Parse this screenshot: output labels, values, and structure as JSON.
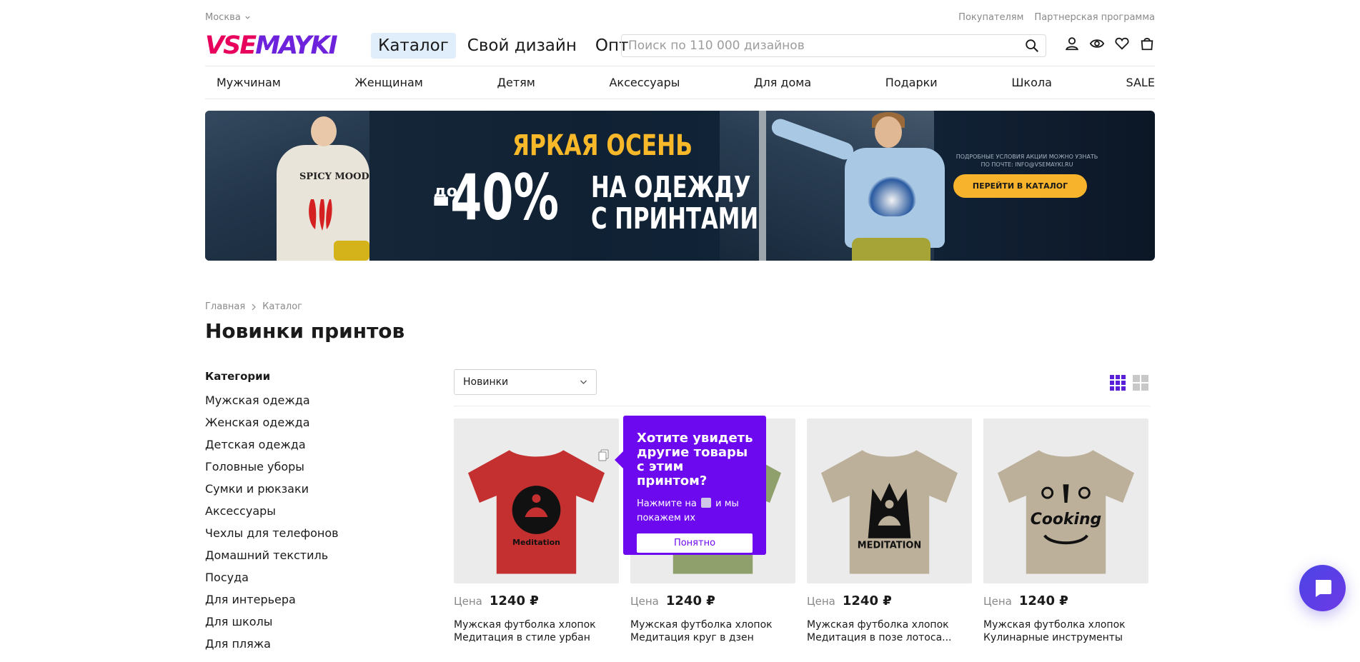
{
  "topline": {
    "city": "Москва",
    "links": [
      "Покупателям",
      "Партнерская программа"
    ]
  },
  "header": {
    "logo": {
      "part1": "VSE",
      "part2": "MAYKI"
    },
    "nav": [
      "Каталог",
      "Свой дизайн",
      "Опт"
    ],
    "search_placeholder": "Поиск по 110 000 дизайнов"
  },
  "catnav": [
    "Мужчинам",
    "Женщинам",
    "Детям",
    "Аксессуары",
    "Для дома",
    "Подарки",
    "Школа",
    "SALE"
  ],
  "banner": {
    "title": "ЯРКАЯ ОСЕНЬ",
    "prefix": "до",
    "percent": "-40%",
    "line1": "НА ОДЕЖДУ",
    "line2": "С ПРИНТАМИ",
    "conditions": "ПОДРОБНЫЕ УСЛОВИЯ АКЦИИ МОЖНО УЗНАТЬ ПО ПОЧТЕ: INFO@VSEMAYKI.RU",
    "button": "ПЕРЕЙТИ В КАТАЛОГ",
    "shirt_text": "SPICY MOOD",
    "colors": {
      "accent": "#f7b829",
      "bg": "#0f2133"
    }
  },
  "breadcrumb": [
    "Главная",
    "Каталог"
  ],
  "page_title": "Новинки принтов",
  "sidebar": {
    "heading": "Категории",
    "items": [
      "Мужская одежда",
      "Женская одежда",
      "Детская одежда",
      "Головные уборы",
      "Сумки и рюкзаки",
      "Аксессуары",
      "Чехлы для телефонов",
      "Домашний текстиль",
      "Посуда",
      "Для интерьера",
      "Для школы",
      "Для пляжа"
    ]
  },
  "sort": {
    "value": "Новинки"
  },
  "products": [
    {
      "price_label": "Цена",
      "price": "1240 ₽",
      "title1": "Мужская футболка хлопок",
      "title2": "Медитация в стиле урбан",
      "shirt_color": "#c43030",
      "print_text": "Meditation"
    },
    {
      "price_label": "Цена",
      "price": "1240 ₽",
      "title1": "Мужская футболка хлопок",
      "title2": "Медитация круг в дзен",
      "shirt_color": "#8fa06c",
      "print_text": ""
    },
    {
      "price_label": "Цена",
      "price": "1240 ₽",
      "title1": "Мужская футболка хлопок",
      "title2": "Медитация в позе лотоса...",
      "shirt_color": "#bcb09a",
      "print_text": "MEDITATION"
    },
    {
      "price_label": "Цена",
      "price": "1240 ₽",
      "title1": "Мужская футболка хлопок",
      "title2": "Кулинарные инструменты",
      "shirt_color": "#bcb09a",
      "print_text": "Cooking"
    }
  ],
  "popover": {
    "heading": "Хотите увидеть другие товары с этим принтом?",
    "text_before": "Нажмите на",
    "text_after": "и мы покажем их",
    "button": "Понятно"
  },
  "icons": {
    "city_chevron": "chevron-down-icon",
    "search": "search-icon",
    "header_icons": [
      "user-icon",
      "eye-icon",
      "heart-icon",
      "bag-icon"
    ],
    "view_switch": [
      "grid-small-icon",
      "grid-large-icon"
    ],
    "chat": "chat-icon"
  }
}
